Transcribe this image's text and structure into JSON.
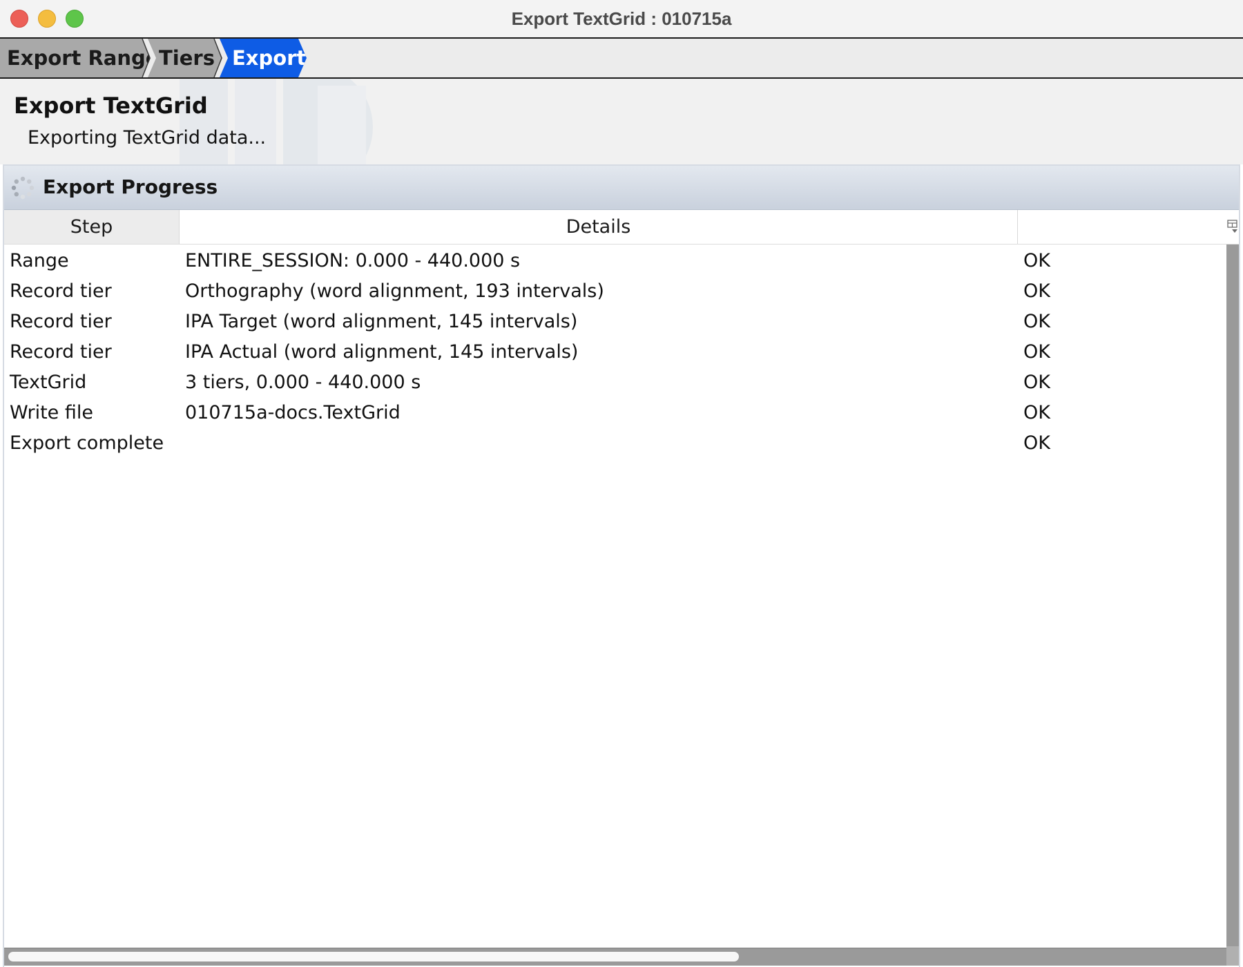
{
  "window": {
    "title": "Export TextGrid : 010715a"
  },
  "breadcrumb": {
    "items": [
      {
        "label": "Export Range",
        "active": false
      },
      {
        "label": "Tiers",
        "active": false
      },
      {
        "label": "Export",
        "active": true
      }
    ],
    "active_color": "#0e5ce5"
  },
  "header": {
    "title": "Export TextGrid",
    "subtitle": "Exporting TextGrid data..."
  },
  "progress_panel": {
    "title": "Export Progress",
    "icon": "spinner-icon",
    "columns": {
      "step": "Step",
      "details": "Details",
      "status": ""
    },
    "rows": [
      {
        "step": "Range",
        "details": "ENTIRE_SESSION: 0.000 - 440.000 s",
        "status": "OK"
      },
      {
        "step": "Record tier",
        "details": "Orthography (word alignment, 193 intervals)",
        "status": "OK"
      },
      {
        "step": "Record tier",
        "details": "IPA Target (word alignment, 145 intervals)",
        "status": "OK"
      },
      {
        "step": "Record tier",
        "details": "IPA Actual (word alignment, 145 intervals)",
        "status": "OK"
      },
      {
        "step": "TextGrid",
        "details": "3 tiers, 0.000 - 440.000 s",
        "status": "OK"
      },
      {
        "step": "Write file",
        "details": "010715a-docs.TextGrid",
        "status": "OK"
      },
      {
        "step": "Export complete",
        "details": "",
        "status": "OK"
      }
    ]
  }
}
